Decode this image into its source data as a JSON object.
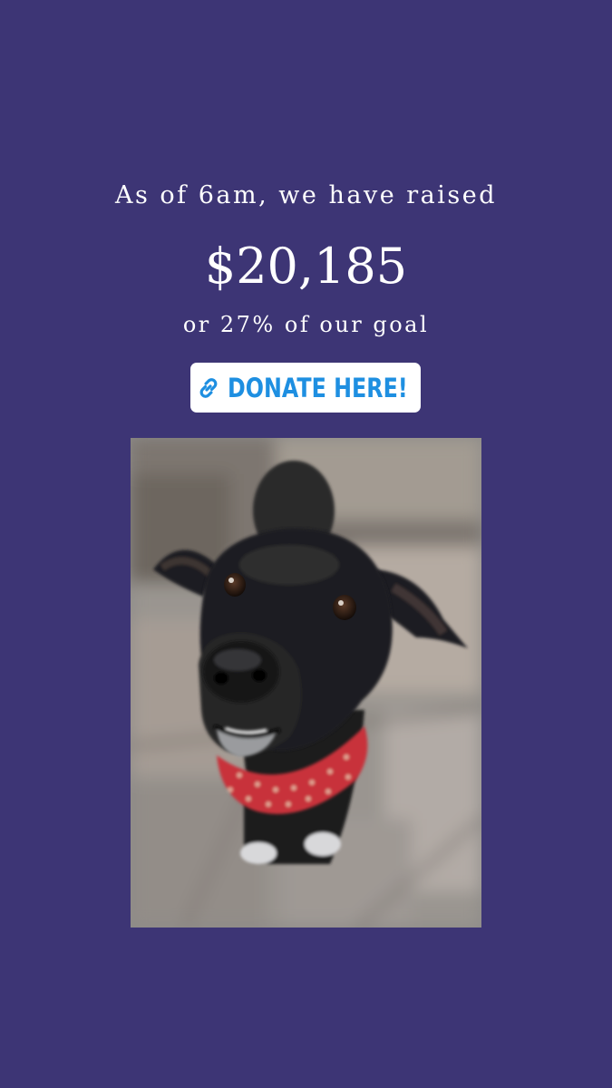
{
  "story": {
    "headline": "As of 6am, we have raised",
    "amount": "$20,185",
    "goal_text": "or 27% of our goal",
    "donate_label": "DONATE HERE!",
    "link_icon": "link-icon",
    "photo_subject": "dog-photo"
  },
  "colors": {
    "background": "#3d3575",
    "text": "#ffffff",
    "donate_text": "#1e8fe1",
    "donate_bg": "#ffffff",
    "bandana": "#c8303a"
  }
}
